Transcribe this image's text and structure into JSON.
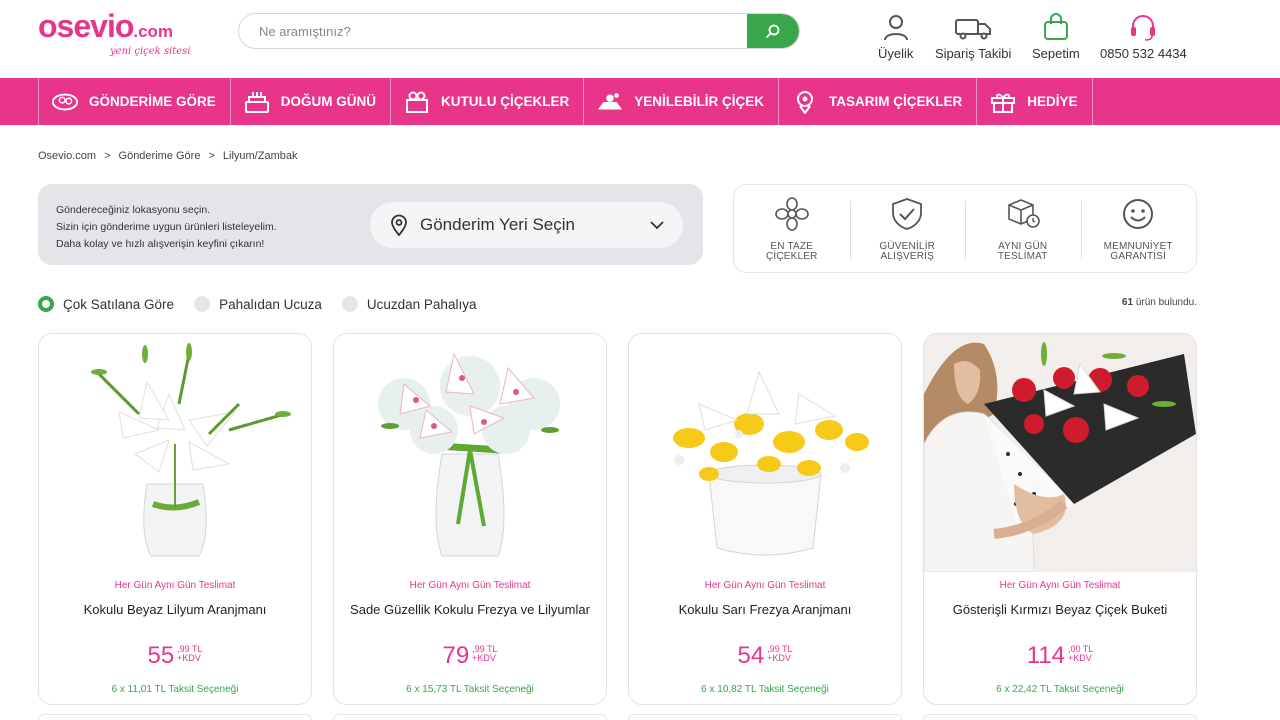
{
  "header": {
    "logo": "osevio.com",
    "logo_main": "osevio",
    "logo_suffix": ".com",
    "logo_tagline": "yeni çiçek sitesi",
    "search_placeholder": "Ne aramıştınız?",
    "items": [
      {
        "label": "Üyelik",
        "icon": "user-icon"
      },
      {
        "label": "Sipariş Takibi",
        "icon": "truck-icon"
      },
      {
        "label": "Sepetim",
        "icon": "shopping-bag-icon"
      },
      {
        "label": "0850 532 4434",
        "icon": "headset-icon"
      }
    ]
  },
  "nav": {
    "items": [
      {
        "label": "GÖNDERİME GÖRE",
        "icon": "bouquet-icon"
      },
      {
        "label": "DOĞUM GÜNÜ",
        "icon": "cake-icon"
      },
      {
        "label": "KUTULU ÇİÇEKLER",
        "icon": "flower-box-icon"
      },
      {
        "label": "YENİLEBİLİR ÇİÇEK",
        "icon": "edible-flower-icon"
      },
      {
        "label": "TASARIM ÇİÇEKLER",
        "icon": "designer-flower-icon"
      },
      {
        "label": "HEDİYE",
        "icon": "gift-icon"
      }
    ]
  },
  "breadcrumb": [
    "Osevio.com",
    "Gönderime Göre",
    "Lilyum/Zambak"
  ],
  "breadcrumb_sep": ">",
  "location": {
    "line1": "Göndereceğiniz lokasyonu seçin.",
    "line2": "Sizin için gönderime uygun ürünleri listeleyelim.",
    "line3": "Daha kolay ve hızlı alışverişin keyfini çıkarın!",
    "select_label": "Gönderim Yeri Seçin"
  },
  "features": [
    {
      "line1": "EN TAZE",
      "line2": "ÇİÇEKLER",
      "icon": "flower-outline-icon"
    },
    {
      "line1": "GÜVENİLİR",
      "line2": "ALIŞVERİŞ",
      "icon": "shield-check-icon"
    },
    {
      "line1": "AYNI GÜN",
      "line2": "TESLİMAT",
      "icon": "package-clock-icon"
    },
    {
      "line1": "MEMNUNİYET",
      "line2": "GARANTİSİ",
      "icon": "smiley-icon"
    }
  ],
  "sort": {
    "options": [
      "Çok Satılana Göre",
      "Pahalıdan Ucuza",
      "Ucuzdan Pahalıya"
    ],
    "selected": 0
  },
  "result_count": "61",
  "result_suffix": "ürün bulundu.",
  "products": [
    {
      "badge": "Her Gün Aynı Gün Teslimat",
      "name": "Kokulu Beyaz Lilyum Aranjmanı",
      "price_int": "55",
      "price_dec": ",99 TL",
      "price_tax": "+KDV",
      "installment": "6 x 11,01 TL Taksit Seçeneği"
    },
    {
      "badge": "Her Gün Aynı Gün Teslimat",
      "name": "Sade Güzellik Kokulu Frezya ve Lilyumlar",
      "price_int": "79",
      "price_dec": ",99 TL",
      "price_tax": "+KDV",
      "installment": "6 x 15,73 TL Taksit Seçeneği"
    },
    {
      "badge": "Her Gün Aynı Gün Teslimat",
      "name": "Kokulu Sarı Frezya Aranjmanı",
      "price_int": "54",
      "price_dec": ",99 TL",
      "price_tax": "+KDV",
      "installment": "6 x 10,82 TL Taksit Seçeneği"
    },
    {
      "badge": "Her Gün Aynı Gün Teslimat",
      "name": "Gösterişli Kırmızı Beyaz Çiçek Buketi",
      "price_int": "114",
      "price_dec": ",00 TL",
      "price_tax": "+KDV",
      "installment": "6 x 22,42 TL Taksit Seçeneği"
    }
  ],
  "colors": {
    "brand_pink": "#e8358a",
    "brand_green": "#38a64a"
  }
}
